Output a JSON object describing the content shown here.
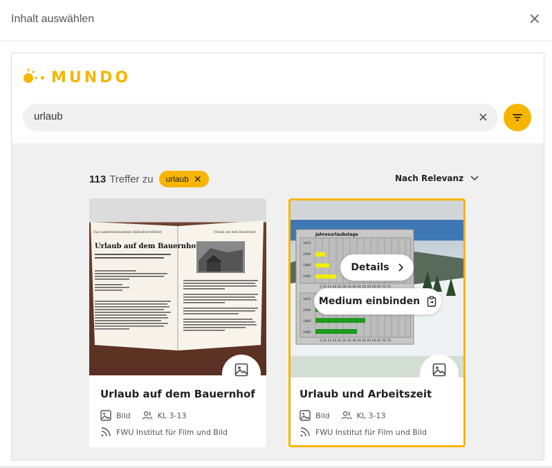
{
  "dialog": {
    "title": "Inhalt auswählen",
    "close_glyph": "×"
  },
  "brand": {
    "name": "MUNDO",
    "color": "#f7b500"
  },
  "search": {
    "value": "urlaub",
    "clear_glyph": "×"
  },
  "results": {
    "count": "113",
    "count_suffix": "Treffer zu",
    "chip_label": "urlaub",
    "chip_remove_glyph": "✕",
    "sort_label": "Nach Relevanz",
    "sort_chevron": "⌄"
  },
  "cards": [
    {
      "title": "Urlaub auf dem Bauernhof",
      "type": "Bild",
      "grade": "KL 3-13",
      "source": "FWU Institut für Film und Bild",
      "selected": false
    },
    {
      "title": "Urlaub und Arbeitszeit",
      "type": "Bild",
      "grade": "KL 3-13",
      "source": "FWU Institut für Film und Bild",
      "selected": true,
      "details_label": "Details",
      "details_chevron": "›",
      "embed_label": "Medium einbinden"
    }
  ],
  "book": {
    "left_header": "Das Landerschulsaheim Alpfachtal erhöhet",
    "right_header": "Urlaub auf dem Bauernhof",
    "heading": "Urlaub auf dem Bauernhof?",
    "intro": "Was Sie besonders beachten sollten, bevor Sie Ferienpäste auf Ihrem Hof aufnehmen!"
  },
  "chart_image": {
    "title": "Jahresurlaubstage",
    "years_top": [
      "1872",
      "1950",
      "1960",
      "1995"
    ],
    "years_bottom": [
      "1872",
      "1950",
      "1960",
      "1995"
    ],
    "axis_ticks": "5 10 15 20 25 30 35 40 45 50 55 60 65 70 75"
  }
}
